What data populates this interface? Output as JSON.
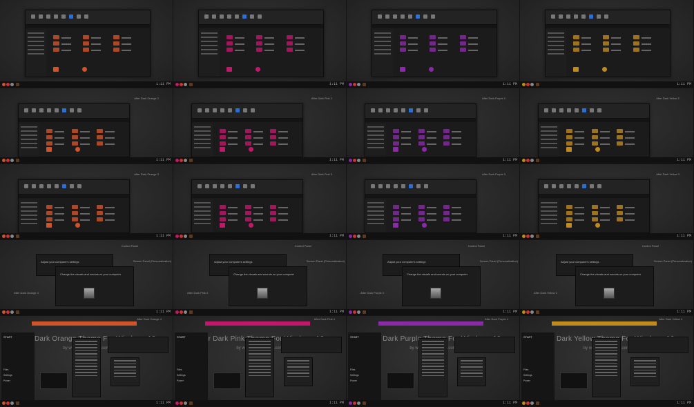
{
  "themes": [
    {
      "key": "orange",
      "name": "After Dark Orange",
      "accent": "#d0542a"
    },
    {
      "key": "pink",
      "name": "After Dark Pink",
      "accent": "#c2186c"
    },
    {
      "key": "purple",
      "name": "After Dark Purple",
      "accent": "#8a2aa6"
    },
    {
      "key": "yellow",
      "name": "After Dark Yellow",
      "accent": "#c08a1e"
    }
  ],
  "captions": {
    "row2": [
      "After Dark Orange 2",
      "After Dark Pink 2",
      "After Dark Purple 2",
      "After Dark Yellow 2"
    ],
    "row3": [
      "After Dark Orange 3",
      "After Dark Pink 3",
      "After Dark Purple 3",
      "After Dark Yellow 3"
    ],
    "row4_control": [
      "Control Panel",
      "Control Panel",
      "Control Panel",
      "Control Panel"
    ],
    "row4_screen": [
      "Screen Panel (Personalization)",
      "Screen Panel (Personalization)",
      "Screen Panel (Personalization)",
      "Screen Panel (Personalization)"
    ],
    "row4_name": [
      "After Dark Orange 4",
      "After Dark Pink 4",
      "After Dark Purple 4",
      "After Dark Yellow 4"
    ],
    "row4_title": "Adjust your computer's settings",
    "row4_sub": "Change the visuals and sounds on your computer",
    "row4b": [
      "After Dark Orange 4",
      "After Dark Pink 4",
      "After Dark Purple 4",
      "After Dark Yellow 4"
    ]
  },
  "big_titles": [
    "After Dark Orange Theme For Windows 10",
    "After Dark Pink Theme For Windows 10",
    "After Dark Purple Theme For Windows 10",
    "After Dark Yellow Theme For Windows 10"
  ],
  "site": "by www.cleodesktop.com",
  "start": {
    "label": "START",
    "items": [
      "Files",
      "Settings",
      "Power"
    ]
  },
  "clock": "1:11 PM"
}
